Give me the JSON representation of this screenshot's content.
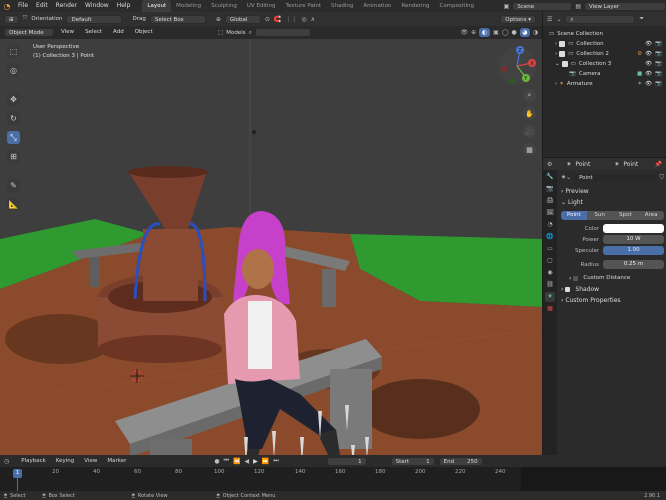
{
  "topbar": {
    "menu": [
      "File",
      "Edit",
      "Render",
      "Window",
      "Help"
    ],
    "workspaces": [
      "Layout",
      "Modeling",
      "Sculpting",
      "UV Editing",
      "Texture Paint",
      "Shading",
      "Animation",
      "Rendering",
      "Compositing"
    ],
    "active_workspace": "Layout",
    "scene": "Scene",
    "view_layer": "View Layer"
  },
  "header": {
    "orientation_label": "Orientation",
    "orientation_value": "Default",
    "drag_label": "Drag",
    "drag_value": "Select Box",
    "global_value": "Global",
    "options_label": "Options"
  },
  "viewport_header": {
    "mode": "Object Mode",
    "menu": [
      "View",
      "Select",
      "Add",
      "Object"
    ],
    "models_label": "Models"
  },
  "viewport": {
    "perspective": "User Perspective",
    "context": "(1) Collection 3 | Point",
    "axis": {
      "x": "X",
      "y": "Y",
      "z": "Z"
    }
  },
  "outliner": {
    "root": "Scene Collection",
    "items": [
      {
        "label": "Collection"
      },
      {
        "label": "Collection 2"
      },
      {
        "label": "Collection 3"
      },
      {
        "label": "Camera"
      },
      {
        "label": "Armature"
      }
    ]
  },
  "properties": {
    "header_object": "Point",
    "header_data": "Point",
    "datablock": "Point",
    "sections": {
      "preview": "Preview",
      "light": "Light",
      "custom_distance": "Custom Distance",
      "shadow": "Shadow",
      "custom_properties": "Custom Properties"
    },
    "light_types": [
      "Point",
      "Sun",
      "Spot",
      "Area"
    ],
    "active_light_type": "Point",
    "fields": {
      "color_label": "Color",
      "power_label": "Power",
      "power_value": "10 W",
      "specular_label": "Specular",
      "specular_value": "1.00",
      "radius_label": "Radius",
      "radius_value": "0.25 m"
    }
  },
  "timeline": {
    "menu": [
      "Playback",
      "Keying",
      "View",
      "Marker"
    ],
    "current_frame": "1",
    "start_label": "Start",
    "start_value": "1",
    "end_label": "End",
    "end_value": "250",
    "ruler": [
      "20",
      "40",
      "60",
      "80",
      "100",
      "120",
      "140",
      "160",
      "180",
      "200",
      "220",
      "240"
    ],
    "playhead": "1"
  },
  "statusbar": {
    "select": "Select",
    "box_select": "Box Select",
    "rotate_view": "Rotate View",
    "context_menu": "Object Context Menu",
    "version": "2.90.1"
  },
  "colors": {
    "accent": "#4a6fa8",
    "grass": "#2f9a2f",
    "ground": "#8a4a2b",
    "hair": "#c640c9",
    "jacket": "#e59ab0"
  }
}
